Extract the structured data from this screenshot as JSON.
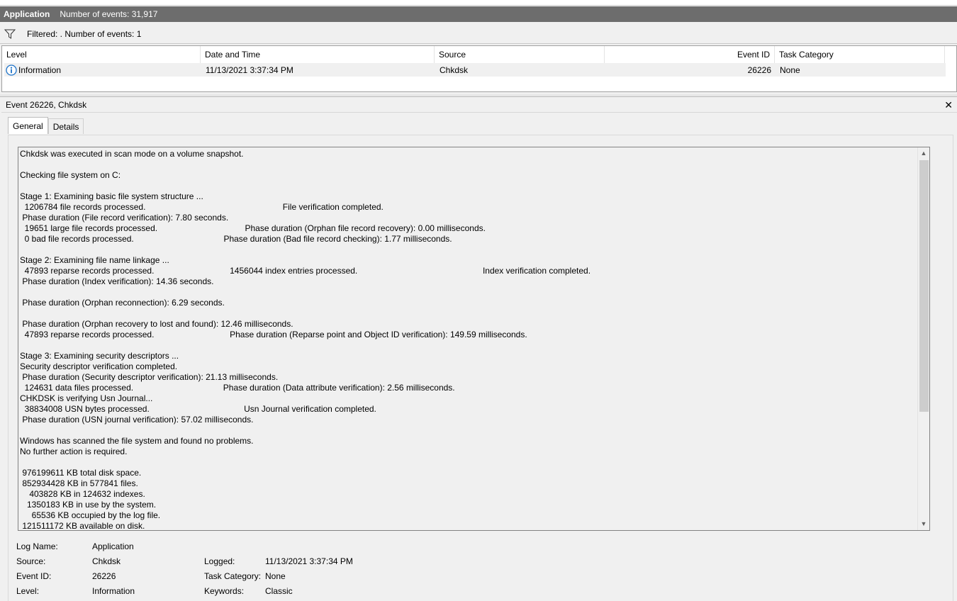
{
  "titlebar": {
    "app": "Application",
    "count": "Number of events: 31,917"
  },
  "filterbar": {
    "text": "Filtered: . Number of events: 1"
  },
  "list": {
    "headers": {
      "level": "Level",
      "datetime": "Date and Time",
      "source": "Source",
      "eventid": "Event ID",
      "category": "Task Category"
    },
    "row": {
      "level": "Information",
      "datetime": "11/13/2021 3:37:34 PM",
      "source": "Chkdsk",
      "eventid": "26226",
      "category": "None"
    }
  },
  "detail": {
    "title": "Event 26226, Chkdsk",
    "tabs": {
      "general": "General",
      "details": "Details"
    },
    "description": "Chkdsk was executed in scan mode on a volume snapshot.\n\nChecking file system on C:\n\nStage 1: Examining basic file system structure ...\n  1206784 file records processed.                                                          File verification completed.\n Phase duration (File record verification): 7.80 seconds.\n  19651 large file records processed.                                     Phase duration (Orphan file record recovery): 0.00 milliseconds.\n  0 bad file records processed.                                      Phase duration (Bad file record checking): 1.77 milliseconds.\n\nStage 2: Examining file name linkage ...\n  47893 reparse records processed.                                1456044 index entries processed.                                                     Index verification completed.\n Phase duration (Index verification): 14.36 seconds.\n\n Phase duration (Orphan reconnection): 6.29 seconds.\n\n Phase duration (Orphan recovery to lost and found): 12.46 milliseconds.\n  47893 reparse records processed.                                Phase duration (Reparse point and Object ID verification): 149.59 milliseconds.\n\nStage 3: Examining security descriptors ...\nSecurity descriptor verification completed.\n Phase duration (Security descriptor verification): 21.13 milliseconds.\n  124631 data files processed.                                      Phase duration (Data attribute verification): 2.56 milliseconds.\nCHKDSK is verifying Usn Journal...\n  38834008 USN bytes processed.                                        Usn Journal verification completed.\n Phase duration (USN journal verification): 57.02 milliseconds.\n\nWindows has scanned the file system and found no problems.\nNo further action is required.\n\n 976199611 KB total disk space.\n 852934428 KB in 577841 files.\n    403828 KB in 124632 indexes.\n   1350183 KB in use by the system.\n     65536 KB occupied by the log file.\n 121511172 KB available on disk."
  },
  "props": {
    "log_name_label": "Log Name:",
    "log_name": "Application",
    "source_label": "Source:",
    "source": "Chkdsk",
    "logged_label": "Logged:",
    "logged": "11/13/2021 3:37:34 PM",
    "event_id_label": "Event ID:",
    "event_id": "26226",
    "task_category_label": "Task Category:",
    "task_category": "None",
    "level_label": "Level:",
    "level": "Information",
    "keywords_label": "Keywords:",
    "keywords": "Classic"
  },
  "colors": {
    "titlebar_bg": "#6d6d6d",
    "info_icon": "#1e73c8"
  }
}
